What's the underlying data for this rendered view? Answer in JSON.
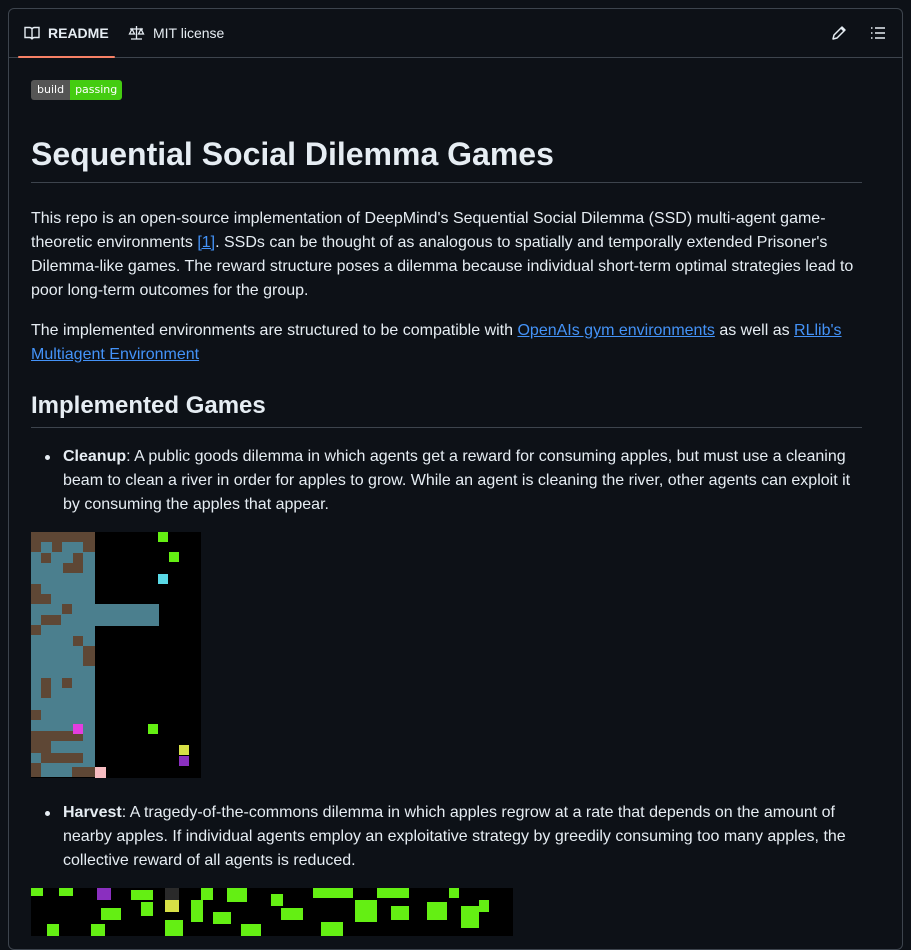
{
  "tabs": [
    {
      "label": "README",
      "icon": "book-icon",
      "active": true
    },
    {
      "label": "MIT license",
      "icon": "scale-icon",
      "active": false
    }
  ],
  "toolbar": {
    "edit_icon": "pencil-icon",
    "toc_icon": "list-icon"
  },
  "badge": {
    "left": "build",
    "right": "passing",
    "right_color": "#4c1"
  },
  "title": "Sequential Social Dilemma Games",
  "intro": {
    "p1_before": "This repo is an open-source implementation of DeepMind's Sequential Social Dilemma (SSD) multi-agent game-theoretic environments ",
    "p1_link": "[1]",
    "p1_after": ". SSDs can be thought of as analogous to spatially and temporally extended Prisoner's Dilemma-like games. The reward structure poses a dilemma because individual short-term optimal strategies lead to poor long-term outcomes for the group.",
    "p2_before": "The implemented environments are structured to be compatible with ",
    "p2_link1": "OpenAIs gym environments",
    "p2_mid": " as well as ",
    "p2_link2": "RLlib's Multiagent Environment"
  },
  "section_title": "Implemented Games",
  "games": [
    {
      "name": "Cleanup",
      "description": ": A public goods dilemma in which agents get a reward for consuming apples, but must use a cleaning beam to clean a river in order for apples to grow. While an agent is cleaning the river, other agents can exploit it by consuming the apples that appear."
    },
    {
      "name": "Harvest",
      "description": ": A tragedy-of-the-commons dilemma in which apples regrow at a rate that depends on the amount of nearby apples. If individual agents employ an exploitative strategy by greedily consuming too many apples, the collective reward of all agents is reduced."
    }
  ],
  "colors": {
    "link": "#4493f8",
    "accent": "#f78166",
    "background": "#0d1117",
    "border": "#3d444d"
  }
}
